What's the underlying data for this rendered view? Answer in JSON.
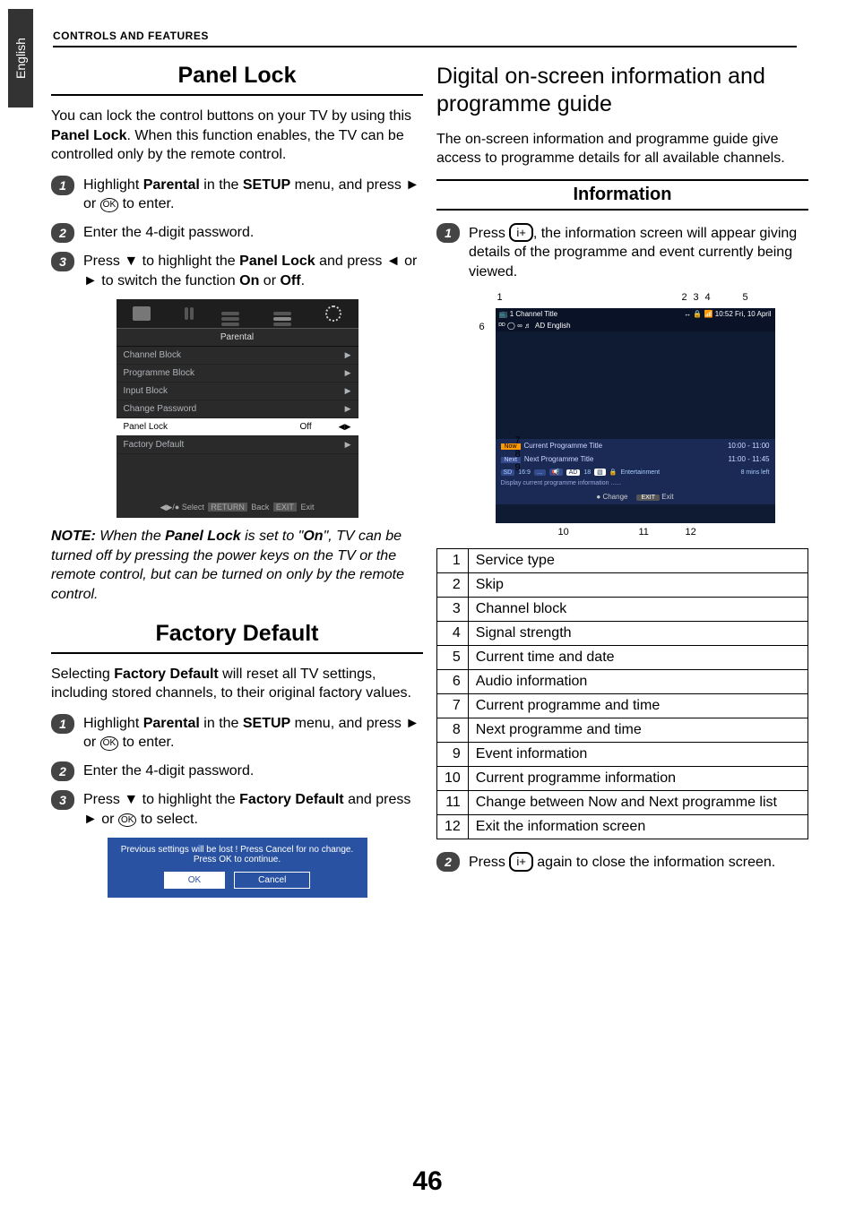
{
  "lang_tab": "English",
  "header": "CONTROLS AND FEATURES",
  "page_number": "46",
  "left": {
    "panel_lock_title": "Panel Lock",
    "panel_lock_intro_a": "You can lock the control buttons on your TV by using this ",
    "panel_lock_intro_b": "Panel Lock",
    "panel_lock_intro_c": ". When this function enables, the TV can be controlled only by the remote control.",
    "pl_step1_a": "Highlight ",
    "pl_step1_b": "Parental",
    "pl_step1_c": " in the ",
    "pl_step1_d": "SETUP",
    "pl_step1_e": " menu, and press ► or ",
    "pl_step1_f": " to enter.",
    "pl_step2": "Enter the 4-digit password.",
    "pl_step3_a": "Press ▼ to highlight the ",
    "pl_step3_b": "Panel Lock",
    "pl_step3_c": " and press ◄ or ► to switch the function ",
    "pl_step3_d": "On",
    "pl_step3_e": " or ",
    "pl_step3_f": "Off",
    "pl_step3_g": ".",
    "menu": {
      "head": "Parental",
      "rows": [
        {
          "label": "Channel Block",
          "val": "",
          "arr": "▶"
        },
        {
          "label": "Programme Block",
          "val": "",
          "arr": "▶"
        },
        {
          "label": "Input Block",
          "val": "",
          "arr": "▶"
        },
        {
          "label": "Change Password",
          "val": "",
          "arr": "▶"
        },
        {
          "label": "Panel Lock",
          "val": "Off",
          "arr": "◀▶"
        },
        {
          "label": "Factory Default",
          "val": "",
          "arr": "▶"
        }
      ],
      "foot_select": "Select",
      "foot_return": "RETURN",
      "foot_back": "Back",
      "foot_exit_btn": "EXIT",
      "foot_exit": "Exit"
    },
    "note_a": "NOTE:",
    "note_b": " When the ",
    "note_c": "Panel Lock",
    "note_d": " is set to \"",
    "note_e": "On",
    "note_f": "\", TV can be turned off by pressing the power keys on the TV or the remote control, but can be turned on only by the remote control.",
    "factory_title": "Factory Default",
    "fd_intro_a": "Selecting ",
    "fd_intro_b": "Factory Default",
    "fd_intro_c": " will reset all TV settings, including stored channels, to their original factory values.",
    "fd_step1_a": "Highlight ",
    "fd_step1_b": "Parental",
    "fd_step1_c": " in the ",
    "fd_step1_d": "SETUP",
    "fd_step1_e": " menu, and press ► or ",
    "fd_step1_f": " to enter.",
    "fd_step2": "Enter the 4-digit password.",
    "fd_step3_a": "Press ▼ to highlight the ",
    "fd_step3_b": "Factory Default",
    "fd_step3_c": " and press ► or ",
    "fd_step3_d": " to select.",
    "dialog_msg": "Previous settings will be lost ! Press Cancel for no change. Press OK to continue.",
    "dialog_ok": "OK",
    "dialog_cancel": "Cancel",
    "ok_glyph": "OK"
  },
  "right": {
    "subtitle": "Digital on-screen information and programme guide",
    "intro": "The on-screen information and programme guide give access to programme details for all available channels.",
    "info_heading": "Information",
    "step1_a": "Press ",
    "step1_b": ", the information screen will appear giving details of the programme and event currently being viewed.",
    "step2_a": "Press  ",
    "step2_b": " again to close the information screen.",
    "info_glyph": "i+",
    "epg": {
      "ch": "1 Channel Title",
      "clock": "10:52 Fri, 10 April",
      "audio": "AD English",
      "now_tag": "Now",
      "now_title": "Current Programme Title",
      "now_time": "10:00 - 11:00",
      "next_tag": "Next",
      "next_title": "Next Programme Title",
      "next_time": "11:00 - 11:45",
      "info_sd": "SD",
      "info_ar": "16:9",
      "info_sub": "…",
      "info_ad": "AD",
      "info_age": "18",
      "info_aud": "▧",
      "info_lock": "🔒",
      "info_genre": "Entertainment",
      "info_left": "8 mins left",
      "desc": "Display current programme information ......",
      "foot_change": "Change",
      "foot_exit_pill": "EXIT",
      "foot_exit": "Exit"
    },
    "callouts": {
      "c1": "1",
      "c2": "2",
      "c3": "3",
      "c4": "4",
      "c5": "5",
      "c6": "6",
      "c7": "7",
      "c8": "8",
      "c9": "9",
      "c10": "10",
      "c11": "11",
      "c12": "12"
    },
    "legend": [
      {
        "n": "1",
        "t": "Service type"
      },
      {
        "n": "2",
        "t": "Skip"
      },
      {
        "n": "3",
        "t": "Channel block"
      },
      {
        "n": "4",
        "t": "Signal strength"
      },
      {
        "n": "5",
        "t": "Current time and date"
      },
      {
        "n": "6",
        "t": "Audio information"
      },
      {
        "n": "7",
        "t": "Current programme and time"
      },
      {
        "n": "8",
        "t": "Next programme and time"
      },
      {
        "n": "9",
        "t": "Event information"
      },
      {
        "n": "10",
        "t": "Current programme information"
      },
      {
        "n": "11",
        "t": "Change between Now and Next programme list"
      },
      {
        "n": "12",
        "t": "Exit the information screen"
      }
    ]
  }
}
